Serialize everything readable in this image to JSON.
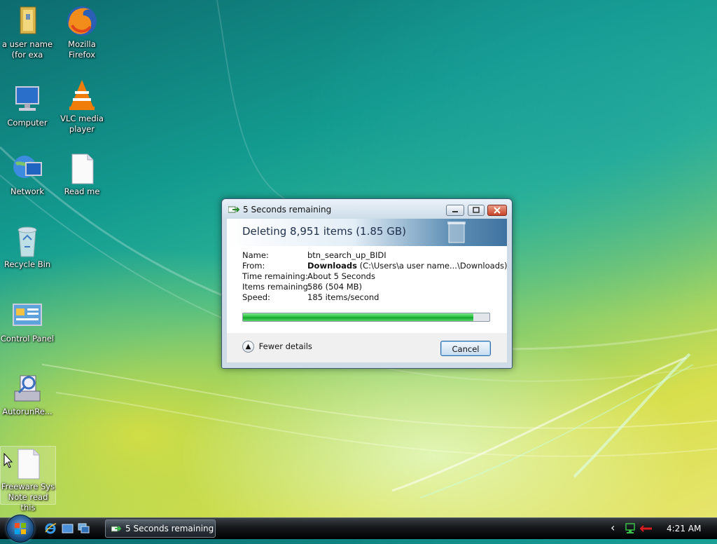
{
  "desktop": {
    "icons": [
      {
        "label": "a user name (for exa",
        "icon": "user-folder-icon"
      },
      {
        "label": "Mozilla Firefox",
        "icon": "firefox-icon"
      },
      {
        "label": "Computer",
        "icon": "computer-icon"
      },
      {
        "label": "VLC media player",
        "icon": "vlc-icon"
      },
      {
        "label": "Network",
        "icon": "network-icon"
      },
      {
        "label": "Read me",
        "icon": "text-file-icon"
      },
      {
        "label": "Recycle Bin",
        "icon": "recycle-bin-icon"
      },
      {
        "label": "Control Panel",
        "icon": "control-panel-icon"
      },
      {
        "label": "AutorunRe...",
        "icon": "autorun-icon"
      },
      {
        "label": "Freeware Sys Note read this",
        "icon": "text-file-icon"
      }
    ]
  },
  "dialog": {
    "title": "5 Seconds remaining",
    "heading": "Deleting 8,951 items (1.85 GB)",
    "details": {
      "name_label": "Name:",
      "name_value": "btn_search_up_BIDI",
      "from_label": "From:",
      "from_folder": "Downloads",
      "from_path": "(C:\\Users\\a user name...\\Downloads)",
      "time_label": "Time remaining:",
      "time_value": "About 5 Seconds",
      "items_label": "Items remaining:",
      "items_value": "586 (504 MB)",
      "speed_label": "Speed:",
      "speed_value": "185 items/second"
    },
    "progress_fraction": 0.935,
    "fewer_details": "Fewer details",
    "cancel": "Cancel"
  },
  "taskbar": {
    "task_label": "5 Seconds remaining",
    "clock": "4:21 AM",
    "tray_expand": "‹"
  },
  "colors": {
    "progress_fill": "#23bd3b",
    "close_button": "#c7452a"
  }
}
